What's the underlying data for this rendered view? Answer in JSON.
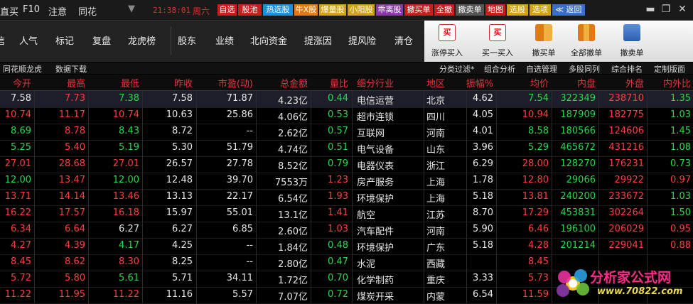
{
  "titlebar": {
    "left_labels": [
      "直买",
      "F10",
      "注意",
      "同花"
    ],
    "clock": "21:38:01",
    "weekday": "周六",
    "quick_buttons": [
      {
        "label": "自选",
        "bg": "#c81e1e"
      },
      {
        "label": "股池",
        "bg": "#c81e1e"
      },
      {
        "label": "热选股",
        "bg": "#1e8fd8"
      },
      {
        "label": "牛X股",
        "bg": "#e07a16"
      },
      {
        "label": "爆量股",
        "bg": "#d0a21a"
      },
      {
        "label": "小阳股",
        "bg": "#d0a21a"
      },
      {
        "label": "乖离股",
        "bg": "#8a3aa8"
      },
      {
        "label": "撤买单",
        "bg": "#c81e1e"
      },
      {
        "label": "全撤",
        "bg": "#c81e1e"
      },
      {
        "label": "撤卖单",
        "bg": "#555555"
      },
      {
        "label": "地图",
        "bg": "#c81e1e"
      },
      {
        "label": "选股",
        "bg": "#d0a21a"
      },
      {
        "label": "选项",
        "bg": "#d0a21a"
      },
      {
        "label": "≪ 返回",
        "bg": "#3b6fc4"
      }
    ]
  },
  "toolbar": {
    "left_items": [
      "信",
      "人气",
      "标记",
      "复盘",
      "龙虎榜",
      "股东",
      "业绩",
      "北向资金",
      "提涨因",
      "提风险",
      "清仓"
    ],
    "right_buttons": [
      {
        "label": "涨停买入",
        "icon": "buy-icon"
      },
      {
        "label": "买一买入",
        "icon": "buy-icon"
      },
      {
        "label": "撤买单",
        "icon": "cancel-buy-icon"
      },
      {
        "label": "全部撤单",
        "icon": "cancel-all-icon"
      },
      {
        "label": "撤卖单",
        "icon": "cancel-sell-icon"
      }
    ]
  },
  "subbar": {
    "left": [
      "同花顺龙虎",
      "数据下载"
    ],
    "right": [
      "分类过滤*",
      "组合分析",
      "自选管理",
      "多股同列",
      "综合排名",
      "定制版面"
    ]
  },
  "table": {
    "columns": [
      "今开",
      "最高",
      "最低",
      "昨收",
      "市盈(动)",
      "总金额",
      "量比",
      "细分行业",
      "地区",
      "振幅%",
      "均价",
      "内盘",
      "外盘",
      "内外比"
    ],
    "rows": [
      [
        "7.58",
        "7.73",
        "7.38",
        "7.58",
        "71.87",
        "4.23亿",
        "0.44",
        "电信运营",
        "北京",
        "4.62",
        "7.54",
        "322349",
        "238710",
        "1.35"
      ],
      [
        "10.74",
        "11.17",
        "10.74",
        "10.63",
        "25.86",
        "4.06亿",
        "0.53",
        "超市连锁",
        "四川",
        "4.05",
        "10.94",
        "187909",
        "182775",
        "1.03"
      ],
      [
        "8.69",
        "8.78",
        "8.43",
        "8.72",
        "--",
        "2.62亿",
        "0.57",
        "互联网",
        "河南",
        "4.01",
        "8.58",
        "180566",
        "124606",
        "1.45"
      ],
      [
        "5.25",
        "5.40",
        "5.19",
        "5.30",
        "51.79",
        "4.74亿",
        "0.51",
        "电气设备",
        "山东",
        "3.96",
        "5.29",
        "465672",
        "431216",
        "1.08"
      ],
      [
        "27.01",
        "28.68",
        "27.01",
        "26.57",
        "27.78",
        "8.52亿",
        "0.79",
        "电器仪表",
        "浙江",
        "6.29",
        "28.00",
        "128270",
        "176231",
        "0.73"
      ],
      [
        "12.00",
        "13.47",
        "12.00",
        "12.48",
        "39.70",
        "7553万",
        "1.23",
        "房产服务",
        "上海",
        "1.78",
        "12.80",
        "29066",
        "29922",
        "0.97"
      ],
      [
        "13.71",
        "14.14",
        "13.46",
        "13.13",
        "22.17",
        "6.54亿",
        "1.93",
        "环境保护",
        "上海",
        "5.18",
        "13.81",
        "240200",
        "233672",
        "1.03"
      ],
      [
        "16.22",
        "17.57",
        "16.18",
        "15.97",
        "55.01",
        "13.1亿",
        "1.41",
        "航空",
        "江苏",
        "8.70",
        "17.29",
        "453831",
        "302264",
        "1.50"
      ],
      [
        "6.34",
        "6.64",
        "6.27",
        "6.27",
        "6.85",
        "2.60亿",
        "1.03",
        "汽车配件",
        "河南",
        "5.90",
        "6.46",
        "196100",
        "206029",
        "0.95"
      ],
      [
        "4.27",
        "4.39",
        "4.17",
        "4.25",
        "--",
        "1.84亿",
        "0.48",
        "环境保护",
        "广东",
        "5.18",
        "4.28",
        "201214",
        "229041",
        "0.88"
      ],
      [
        "8.45",
        "8.62",
        "8.30",
        "8.25",
        "--",
        "2.80亿",
        "0.47",
        "水泥",
        "西藏",
        "",
        "8.45",
        "",
        "",
        ""
      ],
      [
        "5.72",
        "5.80",
        "5.61",
        "5.71",
        "34.11",
        "1.72亿",
        "0.70",
        "化学制药",
        "重庆",
        "3.33",
        "5.73",
        "",
        "",
        ""
      ],
      [
        "11.22",
        "11.95",
        "11.22",
        "11.16",
        "5.57",
        "7.07亿",
        "0.72",
        "煤炭开采",
        "内蒙",
        "6.54",
        "11.59",
        "",
        "",
        ""
      ]
    ],
    "colors": [
      [
        "w",
        "r",
        "g",
        "w",
        "w",
        "w",
        "g",
        "w",
        "w",
        "w",
        "g",
        "g",
        "r",
        "g"
      ],
      [
        "r",
        "r",
        "r",
        "w",
        "w",
        "w",
        "g",
        "w",
        "w",
        "w",
        "r",
        "g",
        "r",
        "g"
      ],
      [
        "g",
        "r",
        "g",
        "w",
        "w",
        "w",
        "g",
        "w",
        "w",
        "w",
        "g",
        "g",
        "r",
        "g"
      ],
      [
        "g",
        "r",
        "g",
        "w",
        "w",
        "w",
        "g",
        "w",
        "w",
        "w",
        "g",
        "g",
        "r",
        "g"
      ],
      [
        "r",
        "r",
        "r",
        "w",
        "w",
        "w",
        "g",
        "w",
        "w",
        "w",
        "r",
        "g",
        "r",
        "g"
      ],
      [
        "g",
        "r",
        "g",
        "w",
        "w",
        "w",
        "r",
        "w",
        "w",
        "w",
        "r",
        "g",
        "r",
        "r"
      ],
      [
        "r",
        "r",
        "r",
        "w",
        "w",
        "w",
        "r",
        "w",
        "w",
        "w",
        "r",
        "g",
        "r",
        "g"
      ],
      [
        "r",
        "r",
        "r",
        "w",
        "w",
        "w",
        "r",
        "w",
        "w",
        "w",
        "r",
        "g",
        "r",
        "g"
      ],
      [
        "r",
        "r",
        "w",
        "w",
        "w",
        "w",
        "r",
        "w",
        "w",
        "w",
        "r",
        "g",
        "r",
        "r"
      ],
      [
        "r",
        "r",
        "g",
        "w",
        "w",
        "w",
        "g",
        "w",
        "w",
        "w",
        "r",
        "g",
        "r",
        "r"
      ],
      [
        "r",
        "r",
        "r",
        "w",
        "w",
        "w",
        "g",
        "w",
        "w",
        "w",
        "r",
        "g",
        "r",
        "r"
      ],
      [
        "r",
        "r",
        "g",
        "w",
        "w",
        "w",
        "g",
        "w",
        "w",
        "w",
        "r",
        "g",
        "r",
        "r"
      ],
      [
        "r",
        "r",
        "r",
        "w",
        "w",
        "w",
        "g",
        "w",
        "w",
        "w",
        "r",
        "g",
        "r",
        "r"
      ]
    ]
  },
  "watermark": {
    "title": "分析家公式网",
    "url": "www.70822.com"
  }
}
